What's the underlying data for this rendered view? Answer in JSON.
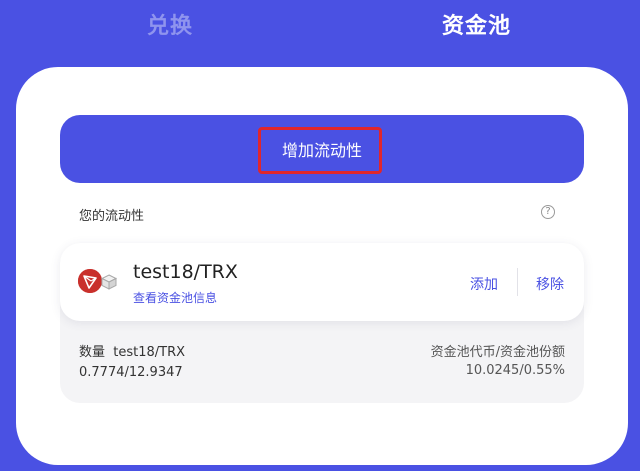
{
  "tabs": {
    "swap_label": "兑换",
    "pool_label": "资金池"
  },
  "actions": {
    "add_liquidity_label": "增加流动性"
  },
  "liquidity": {
    "section_label": "您的流动性",
    "help_glyph": "?"
  },
  "pool": {
    "pair_name": "test18/TRX",
    "info_link": "查看资金池信息",
    "add_label": "添加",
    "remove_label": "移除",
    "quantity_label": "数量",
    "quantity_pair": "test18/TRX",
    "quantity_value": "0.7774/12.9347",
    "share_label": "资金池代币/资金池份额",
    "share_value": "10.0245/0.55%",
    "icons": [
      "trx-token-icon",
      "box-token-icon"
    ]
  },
  "colors": {
    "brand": "#4a51e3",
    "highlight": "#e0262c",
    "trx": "#c9302c"
  }
}
